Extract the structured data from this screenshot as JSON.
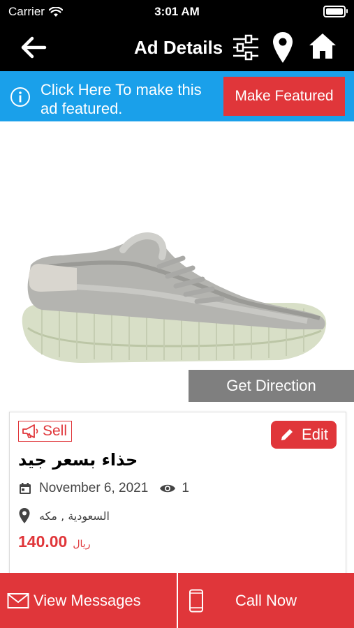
{
  "status_bar": {
    "carrier": "Carrier",
    "time": "3:01 AM"
  },
  "nav": {
    "title": "Ad Details",
    "icons": [
      "back-arrow-icon",
      "sliders-icon",
      "location-pin-icon",
      "home-icon"
    ]
  },
  "banner": {
    "text": "Click Here To make this ad featured.",
    "button_label": "Make Featured",
    "color": "#1aa0ea"
  },
  "product": {
    "image": "grey-sneaker-image"
  },
  "get_direction_label": "Get Direction",
  "ad": {
    "type_badge": "Sell",
    "edit_label": "Edit",
    "title": "حذاء بسعر جيد",
    "date": "November 6, 2021",
    "views": "1",
    "location": "السعودية , مكه",
    "price": "140.00",
    "currency": "ريال"
  },
  "bottom_actions": {
    "messages_label": "View Messages",
    "call_label": "Call Now"
  },
  "colors": {
    "accent_red": "#e0363a",
    "banner_blue": "#1aa0ea",
    "nav_black": "#000000",
    "direction_grey": "#7f7f7f"
  }
}
